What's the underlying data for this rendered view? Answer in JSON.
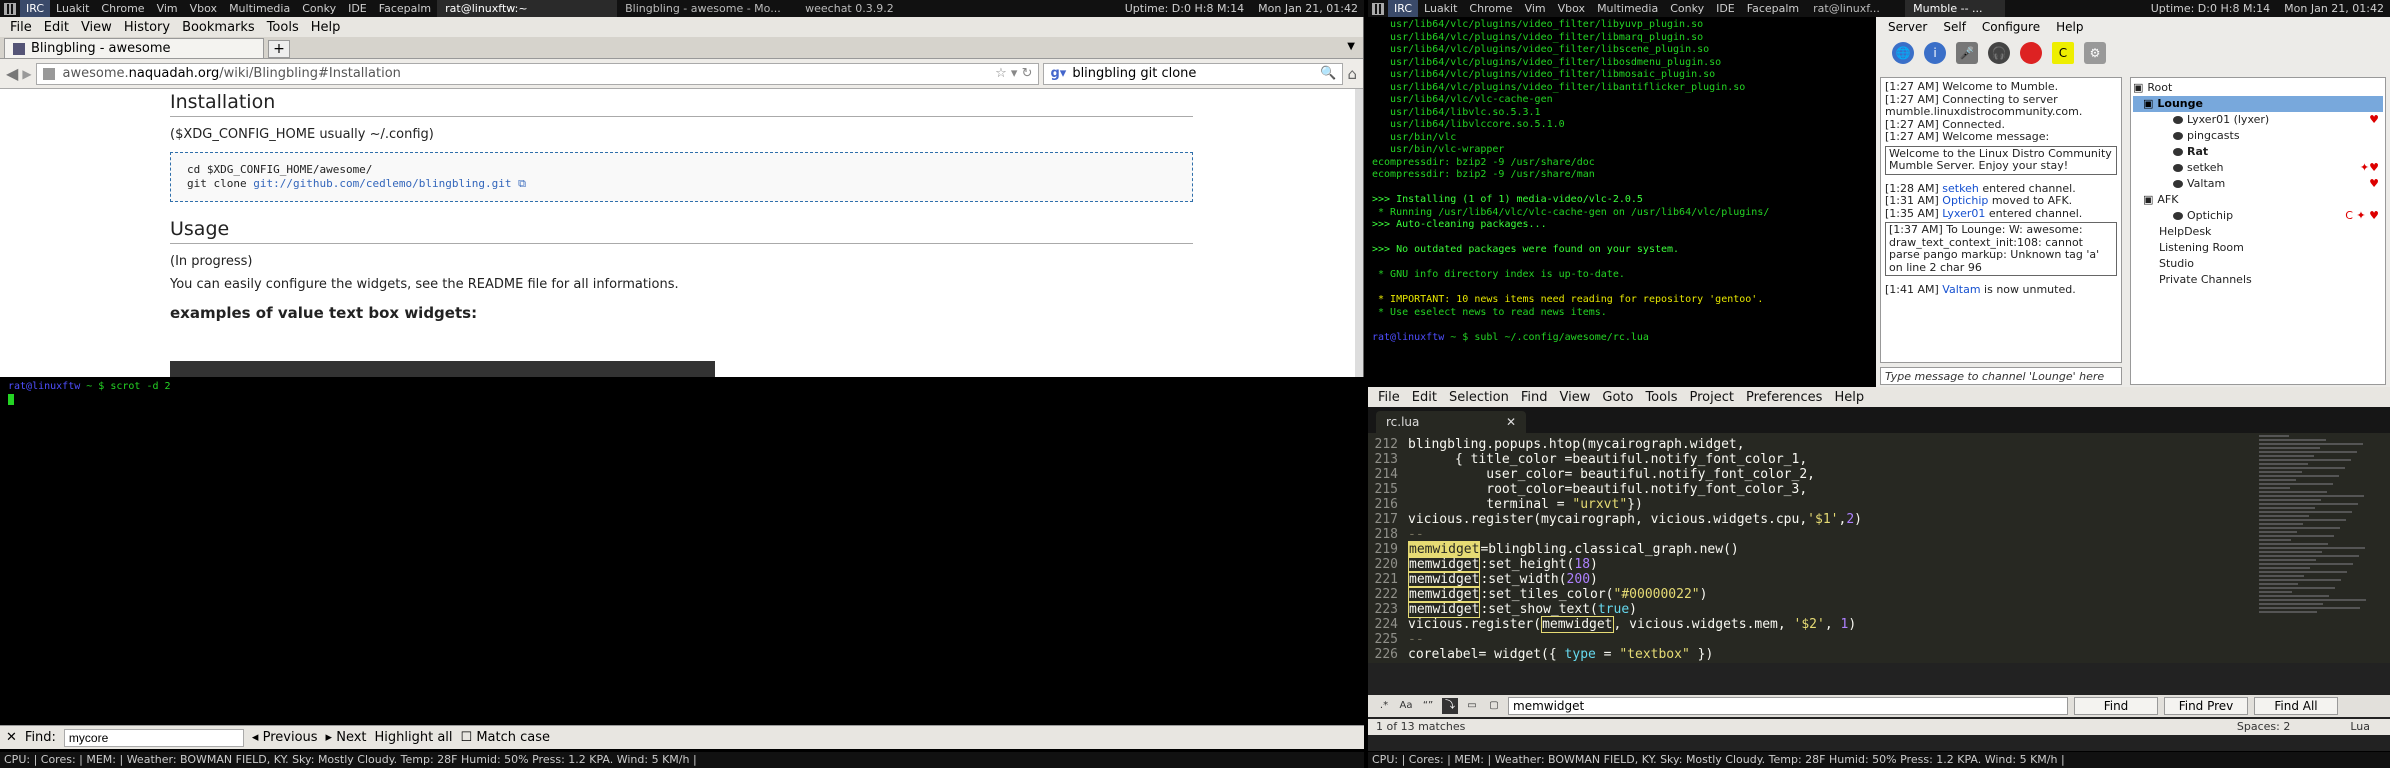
{
  "left_wibar": {
    "tags": [
      "IRC",
      "Luakit",
      "Chrome",
      "Vim",
      "Vbox",
      "Multimedia",
      "Conky",
      "IDE",
      "Facepalm"
    ],
    "focused_task": "rat@linuxftw:~",
    "tasks": [
      "Blingbling - awesome - Mo...",
      "weechat 0.3.9.2"
    ],
    "uptime": "Uptime: D:0 H:8 M:14",
    "clock": "Mon Jan 21, 01:42"
  },
  "right_wibar": {
    "tags": [
      "IRC",
      "Luakit",
      "Chrome",
      "Vim",
      "Vbox",
      "Multimedia",
      "Conky",
      "IDE",
      "Facepalm"
    ],
    "tasks": [
      "rat@linuxf...",
      "Mumble -- ..."
    ],
    "uptime": "Uptime: D:0 H:8 M:14",
    "clock": "Mon Jan 21, 01:42"
  },
  "firefox": {
    "menu": [
      "File",
      "Edit",
      "View",
      "History",
      "Bookmarks",
      "Tools",
      "Help"
    ],
    "tab_title": "Blingbling - awesome",
    "url_prefix": "awesome.",
    "url_domain": "naquadah.org",
    "url_suffix": "/wiki/Blingbling#Installation",
    "search_value": "blingbling git clone",
    "page": {
      "h_install": "Installation",
      "config_note": "($XDG_CONFIG_HOME usually ~/.config)",
      "code1": "cd $XDG_CONFIG_HOME/awesome/",
      "code2": "git clone ",
      "code2_link": "git://github.com/cedlemo/blingbling.git",
      "h_usage": "Usage",
      "progress": "(In progress)",
      "readme": "You can easily configure the widgets, see the README file for all informations.",
      "h_examples": "examples of value text box widgets:"
    },
    "findbar": {
      "label": "Find:",
      "value": "mycore",
      "previous": "Previous",
      "next": "Next",
      "highlight": "Highlight all",
      "match_case": "Match case"
    }
  },
  "term_bottom_left": {
    "prompt_user": "rat@linuxftw",
    "prompt_rest": " ~ $ scrot -d 2"
  },
  "term_top_right": {
    "lines": [
      "   usr/lib64/vlc/plugins/video_filter/libyuvp_plugin.so",
      "   usr/lib64/vlc/plugins/video_filter/libmarq_plugin.so",
      "   usr/lib64/vlc/plugins/video_filter/libscene_plugin.so",
      "   usr/lib64/vlc/plugins/video_filter/libosdmenu_plugin.so",
      "   usr/lib64/vlc/plugins/video_filter/libmosaic_plugin.so",
      "   usr/lib64/vlc/plugins/video_filter/libantiflicker_plugin.so",
      "   usr/lib64/vlc/vlc-cache-gen",
      "   usr/lib64/libvlc.so.5.3.1",
      "   usr/lib64/libvlccore.so.5.1.0",
      "   usr/bin/vlc",
      "   usr/bin/vlc-wrapper",
      "ecompressdir: bzip2 -9 /usr/share/doc",
      "ecompressdir: bzip2 -9 /usr/share/man",
      "",
      ">>> Installing (1 of 1) media-video/vlc-2.0.5",
      " * Running /usr/lib64/vlc/vlc-cache-gen on /usr/lib64/vlc/plugins/",
      ">>> Auto-cleaning packages...",
      "",
      ">>> No outdated packages were found on your system.",
      "",
      " * GNU info directory index is up-to-date.",
      "",
      " * IMPORTANT: 10 news items need reading for repository 'gentoo'.",
      " * Use eselect news to read news items.",
      ""
    ],
    "prompt_user": "rat@linuxftw",
    "prompt_rest": " ~ $ subl ~/.config/awesome/rc.lua"
  },
  "mumble": {
    "menu": [
      "Server",
      "Self",
      "Configure",
      "Help"
    ],
    "log": [
      {
        "t": "[1:27 AM] Welcome to Mumble."
      },
      {
        "t": "[1:27 AM] Connecting to server mumble.linuxdistrocommunity.com."
      },
      {
        "t": "[1:27 AM] Connected."
      },
      {
        "t": "[1:27 AM] Welcome message:"
      }
    ],
    "welcome_box": "Welcome to the Linux Distro Community Mumble Server. Enjoy your stay!",
    "log2": [
      {
        "pre": "[1:28 AM] ",
        "name": "setkeh",
        "post": " entered channel."
      },
      {
        "pre": "[1:31 AM] ",
        "name": "Optichip",
        "post": " moved to AFK."
      },
      {
        "pre": "[1:35 AM] ",
        "name": "Lyxer01",
        "post": " entered channel."
      }
    ],
    "private_box": "[1:37 AM] To Lounge: W: awesome: draw_text_context_init:108: cannot parse pango markup: Unknown tag 'a' on line 2 char 96",
    "last_log": {
      "pre": "[1:41 AM] ",
      "name": "Valtam",
      "post": " is now unmuted."
    },
    "input_placeholder": "Type message to channel 'Lounge' here",
    "tree": {
      "root": "Root",
      "lounge": "Lounge",
      "lounge_users": [
        "Lyxer01 (lyxer)",
        "pingcasts",
        "Rat",
        "setkeh",
        "Valtam"
      ],
      "afk": "AFK",
      "afk_users": [
        "Optichip"
      ],
      "channels": [
        "HelpDesk",
        "Listening Room",
        "Studio",
        "Private Channels"
      ]
    }
  },
  "sublime": {
    "menu": [
      "File",
      "Edit",
      "Selection",
      "Find",
      "View",
      "Goto",
      "Tools",
      "Project",
      "Preferences",
      "Help"
    ],
    "tab": "rc.lua",
    "find_value": "memwidget",
    "find_buttons": [
      "Find",
      "Find Prev",
      "Find All"
    ],
    "status_left": "1 of 13 matches",
    "status_spaces": "Spaces: 2",
    "status_syntax": "Lua"
  },
  "status_bar": {
    "left": "CPU:  | Cores:  | MEM:  | Weather: BOWMAN FIELD, KY. Sky: Mostly Cloudy. Temp: 28F Humid: 50% Press: 1.2 KPA. Wind: 5 KM/h |",
    "right": "CPU:  | Cores:  | MEM:  | Weather: BOWMAN FIELD, KY. Sky: Mostly Cloudy. Temp: 28F Humid: 50% Press: 1.2 KPA. Wind: 5 KM/h |"
  }
}
